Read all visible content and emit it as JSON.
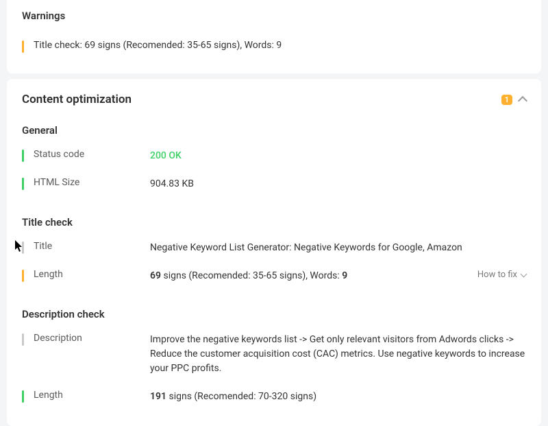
{
  "warnings": {
    "title": "Warnings",
    "item": {
      "prefix": "Title check: ",
      "signs": "69",
      "signsSuffix": " signs (Recomended: 35-65 signs), Words: ",
      "words": "9"
    }
  },
  "contentOpt": {
    "title": "Content optimization",
    "badge": "1"
  },
  "general": {
    "title": "General",
    "statusCode": {
      "label": "Status code",
      "value": "200 OK"
    },
    "htmlSize": {
      "label": "HTML Size",
      "value": "904.83 KB"
    }
  },
  "titleCheck": {
    "title": "Title check",
    "titleRow": {
      "label": "Title",
      "value": "Negative Keyword List Generator: Negative Keywords for Google, Amazon"
    },
    "lengthRow": {
      "label": "Length",
      "signs": "69",
      "mid": " signs (Recomended: 35-65 signs), Words: ",
      "words": "9"
    },
    "howToFix": "How to fix"
  },
  "descCheck": {
    "title": "Description check",
    "descRow": {
      "label": "Description",
      "value": "Improve the negative keywords list -> Get only relevant visitors from Adwords clicks -> Reduce the customer acquisition cost (CAC) metrics. Use negative keywords to increase your PPC profits."
    },
    "lengthRow": {
      "label": "Length",
      "signs": "191",
      "suffix": " signs (Recomended: 70-320 signs)"
    }
  }
}
